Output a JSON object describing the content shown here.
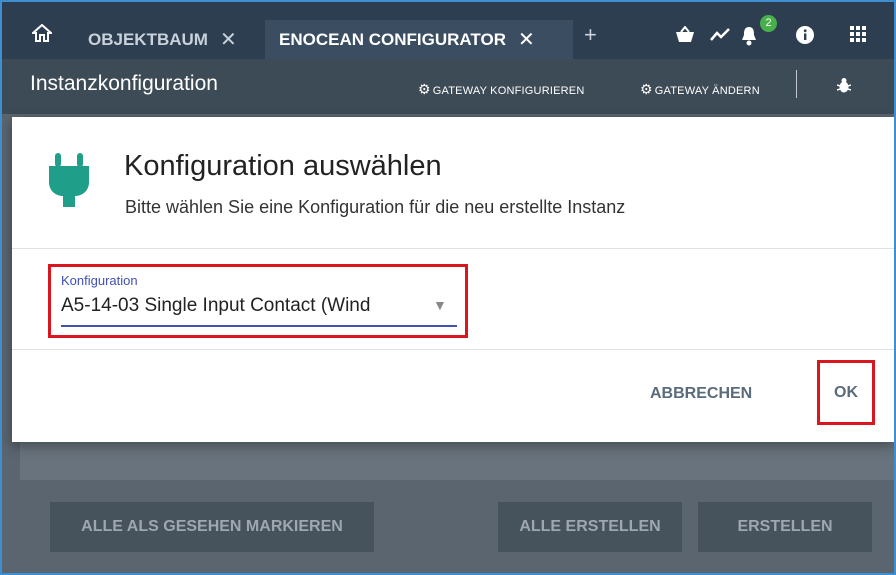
{
  "topbar": {
    "home_icon": "home-icon",
    "tabs": [
      {
        "label": "OBJEKTBAUM",
        "close": "✕"
      },
      {
        "label": "ENOCEAN CONFIGURATOR",
        "close": "✕"
      }
    ],
    "add_tab": "+",
    "notification_count": "2",
    "icons": [
      "basket-icon",
      "chart-icon",
      "bell-icon",
      "info-icon",
      "apps-icon"
    ]
  },
  "instance_bar": {
    "title": "Instanzkonfiguration",
    "gateway_configure": "GATEWAY KONFIGURIEREN",
    "gateway_change": "GATEWAY ÄNDERN",
    "debug_icon": "bug-icon"
  },
  "dialog": {
    "title": "Konfiguration auswählen",
    "subtitle": "Bitte wählen Sie eine Konfiguration für die neu erstellte Instanz",
    "field_label": "Konfiguration",
    "field_value": "A5-14-03 Single Input Contact (Wind",
    "cancel_label": "ABBRECHEN",
    "ok_label": "OK",
    "accent_color": "#3f51b5",
    "highlight_color": "#d9151d",
    "plug_color": "#1f9e8a"
  },
  "background_buttons": {
    "mark_all_seen": "ALLE ALS GESEHEN MARKIEREN",
    "create_all": "ALLE ERSTELLEN",
    "create": "ERSTELLEN"
  }
}
